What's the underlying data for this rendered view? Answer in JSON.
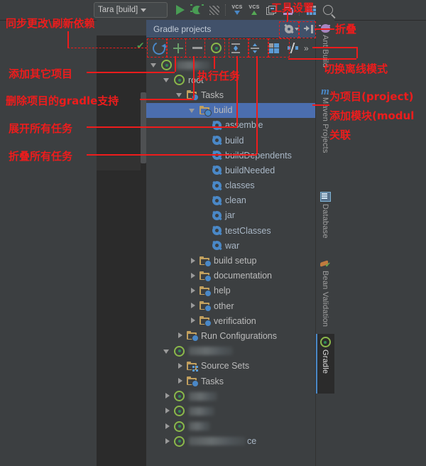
{
  "window": {
    "ide_toolbar": {
      "run_config": "Tara [build]",
      "icons": [
        {
          "name": "run-icon",
          "label": "Run"
        },
        {
          "name": "debug-icon",
          "label": "Debug"
        },
        {
          "name": "coverage-icon",
          "label": "Run with Coverage"
        },
        {
          "name": "vcs-update-icon",
          "label": "VCS"
        },
        {
          "name": "vcs-commit-icon",
          "label": "VCS"
        },
        {
          "name": "vcs-history-icon",
          "label": "Show History"
        },
        {
          "name": "undo-icon",
          "label": "Rollback"
        },
        {
          "name": "database-icon",
          "label": "Database"
        },
        {
          "name": "search-icon",
          "label": "Search Everywhere"
        }
      ],
      "vcs_label": "VCS"
    },
    "tool_window": {
      "title": "Gradle projects",
      "header_buttons": [
        {
          "name": "settings-gear-button",
          "label": "Settings"
        },
        {
          "name": "hide-window-button",
          "label": "Hide"
        }
      ],
      "toolbar_buttons": [
        {
          "name": "refresh-all-button",
          "label": "Refresh all Gradle projects"
        },
        {
          "name": "attach-project-button",
          "label": "Attach Gradle project"
        },
        {
          "name": "detach-project-button",
          "label": "Detach external project"
        },
        {
          "name": "execute-task-button",
          "label": "Execute Gradle Task"
        },
        {
          "name": "expand-all-button",
          "label": "Expand All"
        },
        {
          "name": "collapse-all-button",
          "label": "Collapse All"
        },
        {
          "name": "show-structure-button",
          "label": "Gradle Settings"
        },
        {
          "name": "toggle-offline-button",
          "label": "Toggle Offline Mode"
        },
        {
          "name": "overflow-button",
          "label": "»"
        }
      ]
    },
    "tree": {
      "nodes": [
        {
          "depth": 0,
          "state": "open",
          "icon": "gradle-project-icon",
          "label": "",
          "blurred": true,
          "blur_w": 48
        },
        {
          "depth": 1,
          "state": "open",
          "icon": "gradle-module-icon",
          "label": "root",
          "blurred": false
        },
        {
          "depth": 2,
          "state": "open",
          "icon": "folder-tasks-icon",
          "label": "Tasks"
        },
        {
          "depth": 3,
          "state": "open",
          "icon": "folder-tasks-icon",
          "label": "build",
          "selected": true
        },
        {
          "depth": 4,
          "state": "leaf",
          "icon": "task-cog-icon",
          "label": "assemble"
        },
        {
          "depth": 4,
          "state": "leaf",
          "icon": "task-cog-icon",
          "label": "build"
        },
        {
          "depth": 4,
          "state": "leaf",
          "icon": "task-cog-icon",
          "label": "buildDependents"
        },
        {
          "depth": 4,
          "state": "leaf",
          "icon": "task-cog-icon",
          "label": "buildNeeded"
        },
        {
          "depth": 4,
          "state": "leaf",
          "icon": "task-cog-icon",
          "label": "classes"
        },
        {
          "depth": 4,
          "state": "leaf",
          "icon": "task-cog-icon",
          "label": "clean"
        },
        {
          "depth": 4,
          "state": "leaf",
          "icon": "task-cog-icon",
          "label": "jar"
        },
        {
          "depth": 4,
          "state": "leaf",
          "icon": "task-cog-icon",
          "label": "testClasses"
        },
        {
          "depth": 4,
          "state": "leaf",
          "icon": "task-cog-icon",
          "label": "war"
        },
        {
          "depth": 3,
          "state": "closed",
          "icon": "folder-tasks-icon",
          "label": "build setup"
        },
        {
          "depth": 3,
          "state": "closed",
          "icon": "folder-tasks-icon",
          "label": "documentation"
        },
        {
          "depth": 3,
          "state": "closed",
          "icon": "folder-tasks-icon",
          "label": "help"
        },
        {
          "depth": 3,
          "state": "closed",
          "icon": "folder-tasks-icon",
          "label": "other"
        },
        {
          "depth": 3,
          "state": "closed",
          "icon": "folder-tasks-icon",
          "label": "verification"
        },
        {
          "depth": 2,
          "state": "closed",
          "icon": "folder-runconfig-icon",
          "label": "Run Configurations"
        },
        {
          "depth": 1,
          "state": "open",
          "icon": "gradle-module-icon",
          "label": "",
          "blurred": true,
          "blur_w": 62
        },
        {
          "depth": 2,
          "state": "closed",
          "icon": "folder-sourcesets-icon",
          "label": "Source Sets"
        },
        {
          "depth": 2,
          "state": "closed",
          "icon": "folder-tasks-icon",
          "label": "Tasks"
        },
        {
          "depth": 1,
          "state": "closed",
          "icon": "gradle-module-icon",
          "label": "",
          "blurred": true,
          "blur_w": 40
        },
        {
          "depth": 1,
          "state": "closed",
          "icon": "gradle-module-icon",
          "label": "",
          "blurred": true,
          "blur_w": 36
        },
        {
          "depth": 1,
          "state": "closed",
          "icon": "gradle-module-icon",
          "label": "",
          "blurred": true,
          "blur_w": 30
        },
        {
          "depth": 1,
          "state": "closed",
          "icon": "gradle-module-icon",
          "label": "ce",
          "blurred": true,
          "blur_w": 80
        }
      ]
    },
    "right_tabs": [
      {
        "name": "tab-ant-build",
        "label": "Ant Build",
        "icon": "ant-bug-icon",
        "active": false
      },
      {
        "name": "tab-maven-projects",
        "label": "Maven Projects",
        "icon": "maven-m-icon",
        "active": false
      },
      {
        "name": "tab-database",
        "label": "Database",
        "icon": "database-icon",
        "active": false
      },
      {
        "name": "tab-bean-validation",
        "label": "Bean Validation",
        "icon": "bean-leaf-icon",
        "active": false
      },
      {
        "name": "tab-gradle",
        "label": "Gradle",
        "icon": "gradle-elephant-icon",
        "active": true
      }
    ]
  },
  "annotations": [
    {
      "name": "annotation-sync-refresh",
      "text": "同步更改\\刷新依赖"
    },
    {
      "name": "annotation-add-other-project",
      "text": "添加其它项目"
    },
    {
      "name": "annotation-remove-gradle-support",
      "text": "删除项目的gradle支持"
    },
    {
      "name": "annotation-expand-all-tasks",
      "text": "展开所有任务"
    },
    {
      "name": "annotation-collapse-all-tasks",
      "text": "折叠所有任务"
    },
    {
      "name": "annotation-execute-task",
      "text": "执行任务"
    },
    {
      "name": "annotation-tool-settings",
      "text": "工具设置"
    },
    {
      "name": "annotation-collapse",
      "text": "折叠"
    },
    {
      "name": "annotation-toggle-offline",
      "text": "切换离线模式"
    },
    {
      "name": "annotation-link-project",
      "text": "为项目(project)"
    },
    {
      "name": "annotation-add-module",
      "text": "添加模块(modul"
    },
    {
      "name": "annotation-association",
      "text": "关联"
    }
  ],
  "colors": {
    "background": "#3c3f41",
    "editor_bg": "#2b2b2b",
    "selection": "#4b6eaf",
    "header": "#41516a",
    "annotation_red": "#ee1c1c",
    "tree_text": "#a9b7c6"
  }
}
